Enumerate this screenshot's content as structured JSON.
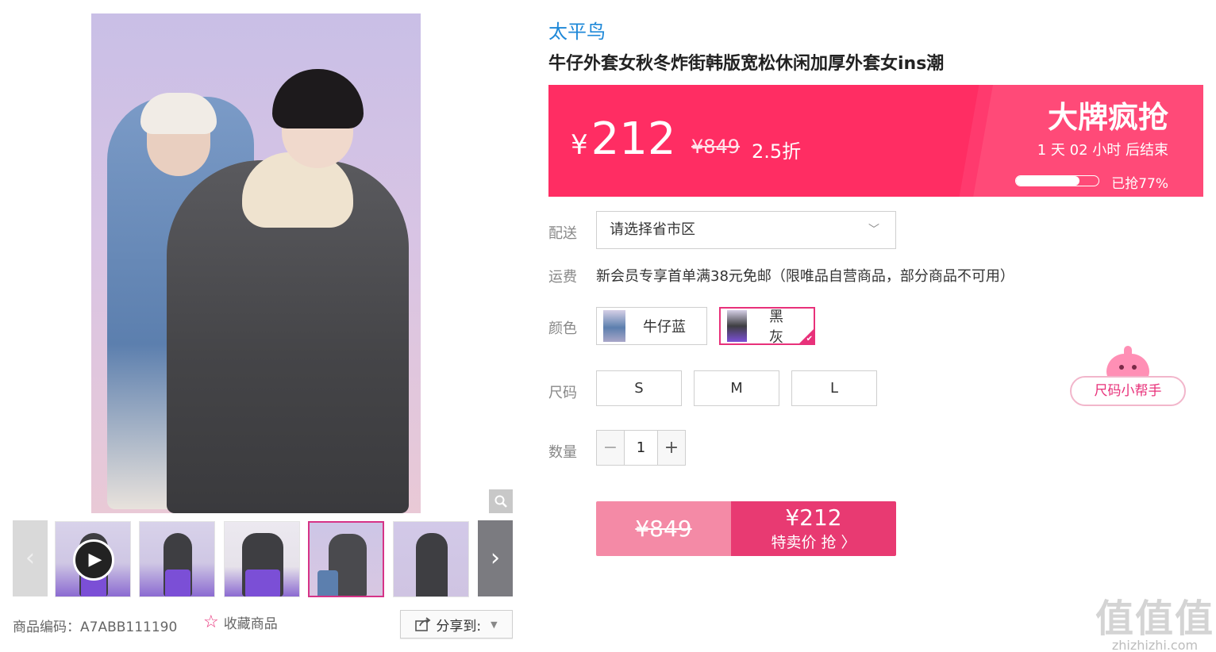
{
  "gallery": {
    "zoom_icon": "magnifier-icon",
    "prev_icon": "chevron-left-icon",
    "next_icon": "chevron-right-icon",
    "play_icon": "play-icon",
    "product_code_label": "商品编码：",
    "product_code": "A7ABB111190",
    "favorite_label": "收藏商品",
    "share_label": "分享到:"
  },
  "product": {
    "brand": "太平鸟",
    "title": "牛仔外套女秋冬炸街韩版宽松休闲加厚外套女ins潮"
  },
  "price_banner": {
    "currency": "¥",
    "current_price": "212",
    "original_price": "¥849",
    "discount": "2.5折",
    "promo_title": "大牌疯抢",
    "countdown": "1 天 02 小时 后结束",
    "sold_percent": 77,
    "sold_label": "已抢77%"
  },
  "delivery": {
    "label": "配送",
    "select_placeholder": "请选择省市区"
  },
  "shipping": {
    "label": "运费",
    "text": "新会员专享首单满38元免邮（限唯品自营商品，部分商品不可用）"
  },
  "color": {
    "label": "颜色",
    "options": [
      {
        "name": "牛仔蓝",
        "selected": false
      },
      {
        "name": "黑灰",
        "selected": true
      }
    ]
  },
  "size": {
    "label": "尺码",
    "options": [
      "S",
      "M",
      "L"
    ],
    "helper_label": "尺码小帮手"
  },
  "quantity": {
    "label": "数量",
    "minus": "−",
    "value": "1",
    "plus": "+"
  },
  "buy": {
    "original_price": "¥849",
    "sale_price": "¥212",
    "cta": "特卖价 抢 〉"
  },
  "watermark": {
    "big": "值值值",
    "small": "zhizhizhi.com"
  },
  "colors": {
    "brand_blue": "#1e88d8",
    "banner_pink": "#ff2d63",
    "accent_pink": "#e8317a",
    "buy_dark": "#e83a72",
    "buy_light": "#f48aa6"
  }
}
